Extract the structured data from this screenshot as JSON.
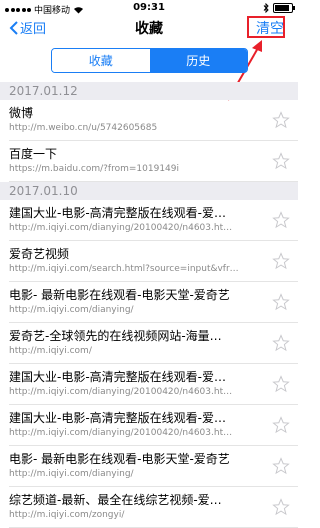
{
  "status": {
    "carrier": "中国移动",
    "time": "09:31"
  },
  "nav": {
    "back_label": "返回",
    "title": "收藏",
    "clear_label": "清空"
  },
  "tabs": [
    {
      "label": "收藏"
    },
    {
      "label": "历史"
    }
  ],
  "sections": [
    {
      "date": "2017.01.12",
      "items": [
        {
          "title": "微博",
          "url": "http://m.weibo.cn/u/5742605685"
        },
        {
          "title": "百度一下",
          "url": "https://m.baidu.com/?from=1019149i"
        }
      ]
    },
    {
      "date": "2017.01.10",
      "items": [
        {
          "title": "建国大业-电影-高清完整版在线观看-爱…",
          "url": "http://m.iqiyi.com/dianying/20100420/n4603.ht…"
        },
        {
          "title": "爱奇艺视频",
          "url": "http://m.iqiyi.com/search.html?source=input&vfr…"
        },
        {
          "title": "电影- 最新电影在线观看-电影天堂-爱奇艺",
          "url": "http://m.iqiyi.com/dianying/"
        },
        {
          "title": "爱奇艺-全球领先的在线视频网站-海量…",
          "url": "http://m.iqiyi.com/"
        },
        {
          "title": "建国大业-电影-高清完整版在线观看-爱…",
          "url": "http://m.iqiyi.com/dianying/20100420/n4603.ht…"
        },
        {
          "title": "建国大业-电影-高清完整版在线观看-爱…",
          "url": "http://m.iqiyi.com/dianying/20100420/n4603.ht…"
        },
        {
          "title": "电影- 最新电影在线观看-电影天堂-爱奇艺",
          "url": "http://m.iqiyi.com/dianying/"
        },
        {
          "title": "综艺频道-最新、最全在线综艺视频-爱…",
          "url": "http://m.iqiyi.com/zongyi/"
        }
      ]
    }
  ]
}
